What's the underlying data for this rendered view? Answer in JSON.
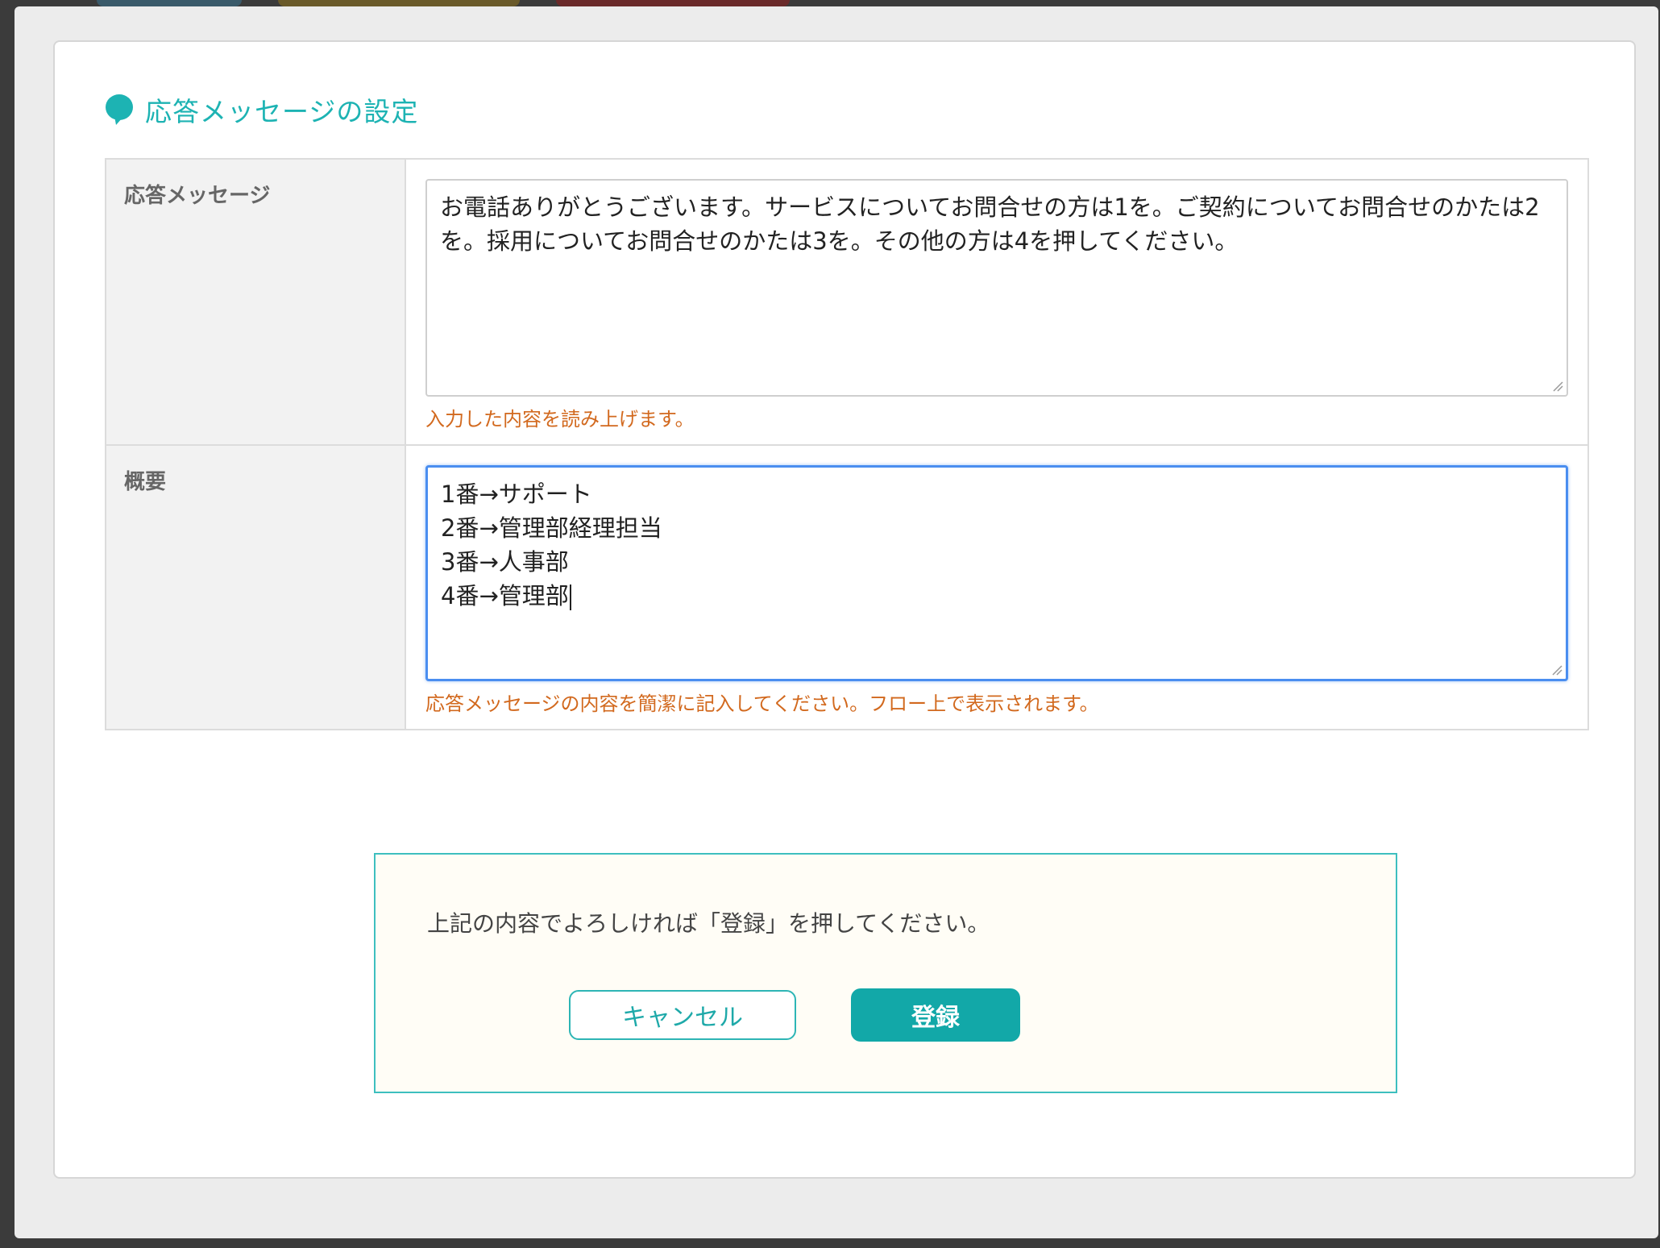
{
  "dialog": {
    "title": "応答メッセージの設定",
    "title_icon": "speech-bubble-icon"
  },
  "form": {
    "message": {
      "label": "応答メッセージ",
      "value": "お電話ありがとうございます。サービスについてお問合せの方は1を。ご契約についてお問合せのかたは2を。採用についてお問合せのかたは3を。その他の方は4を押してください。",
      "hint": "入力した内容を読み上げます。"
    },
    "summary": {
      "label": "概要",
      "lines": [
        "1番→サポート",
        "2番→管理部経理担当",
        "3番→人事部",
        "4番→管理部"
      ],
      "hint": "応答メッセージの内容を簡潔に記入してください。フロー上で表示されます。"
    }
  },
  "confirm": {
    "text": "上記の内容でよろしければ「登録」を押してください。",
    "cancel_label": "キャンセル",
    "register_label": "登録"
  },
  "colors": {
    "accent": "#1db3b3",
    "hint": "#d2691e",
    "focus": "#4a8ef0",
    "button": "#12a8a8"
  }
}
